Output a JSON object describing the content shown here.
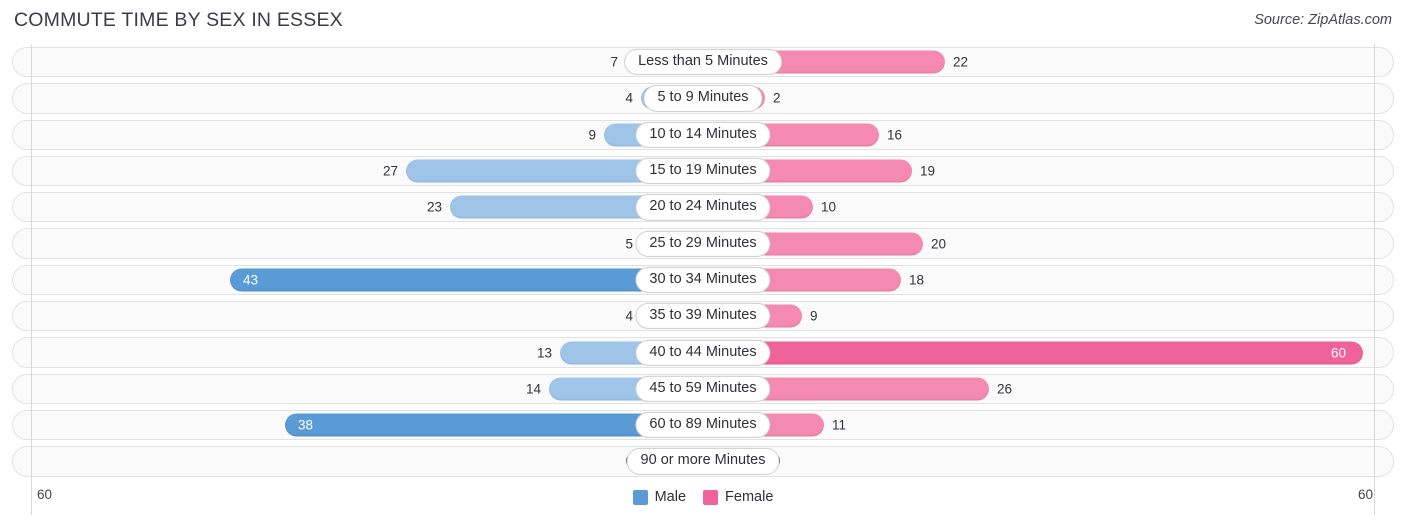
{
  "header": {
    "title": "COMMUTE TIME BY SEX IN ESSEX",
    "source": "Source: ZipAtlas.com"
  },
  "axis": {
    "left_max_label": "60",
    "right_max_label": "60"
  },
  "legend": {
    "items": [
      {
        "label": "Male",
        "color": "#5b9bd5"
      },
      {
        "label": "Female",
        "color": "#f0629a"
      }
    ]
  },
  "colors": {
    "male_light": "#9ec5e8",
    "male_dark": "#5b9bd5",
    "female_light": "#f58ab0",
    "female_dark": "#f0629a",
    "track_bg": "#fafafa",
    "track_border": "#e2e2e2"
  },
  "chart_data": {
    "type": "bar",
    "subtype": "diverging-bar",
    "title": "COMMUTE TIME BY SEX IN ESSEX",
    "xlabel": "",
    "ylabel": "",
    "xlim": [
      60,
      60
    ],
    "grid": false,
    "legend_position": "bottom-center",
    "categories": [
      "Less than 5 Minutes",
      "5 to 9 Minutes",
      "10 to 14 Minutes",
      "15 to 19 Minutes",
      "20 to 24 Minutes",
      "25 to 29 Minutes",
      "30 to 34 Minutes",
      "35 to 39 Minutes",
      "40 to 44 Minutes",
      "45 to 59 Minutes",
      "60 to 89 Minutes",
      "90 or more Minutes"
    ],
    "series": [
      {
        "name": "Male",
        "direction": "left",
        "color": "#5b9bd5",
        "values": [
          7,
          4,
          9,
          27,
          23,
          5,
          43,
          4,
          13,
          14,
          38,
          0
        ]
      },
      {
        "name": "Female",
        "direction": "right",
        "color": "#f0629a",
        "values": [
          22,
          2,
          16,
          19,
          10,
          20,
          18,
          9,
          60,
          26,
          11,
          0
        ]
      }
    ]
  }
}
